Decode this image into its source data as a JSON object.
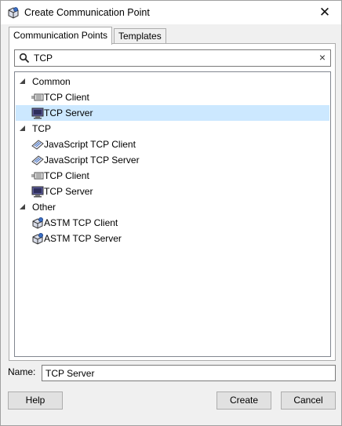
{
  "window": {
    "title": "Create Communication Point",
    "close_glyph": "✕"
  },
  "tabs": [
    {
      "label": "Communication Points",
      "active": true
    },
    {
      "label": "Templates",
      "active": false
    }
  ],
  "search": {
    "value": "TCP",
    "clear_glyph": "×"
  },
  "tree": {
    "groups": [
      {
        "label": "Common",
        "items": [
          {
            "label": "TCP Client",
            "icon": "tcp-client-icon"
          },
          {
            "label": "TCP Server",
            "icon": "tcp-server-icon",
            "selected": true
          }
        ]
      },
      {
        "label": "TCP",
        "items": [
          {
            "label": "JavaScript TCP Client",
            "icon": "javascript-icon"
          },
          {
            "label": "JavaScript TCP Server",
            "icon": "javascript-icon"
          },
          {
            "label": "TCP Client",
            "icon": "tcp-client-icon"
          },
          {
            "label": "TCP Server",
            "icon": "tcp-server-icon"
          }
        ]
      },
      {
        "label": "Other",
        "items": [
          {
            "label": "ASTM TCP Client",
            "icon": "astm-icon"
          },
          {
            "label": "ASTM TCP Server",
            "icon": "astm-icon"
          }
        ]
      }
    ]
  },
  "name_field": {
    "label": "Name:",
    "value": "TCP Server"
  },
  "buttons": {
    "help": "Help",
    "create": "Create",
    "cancel": "Cancel"
  },
  "colors": {
    "selection": "#cce8ff",
    "button_face": "#e1e1e1",
    "window_bg": "#f0f0f0"
  }
}
